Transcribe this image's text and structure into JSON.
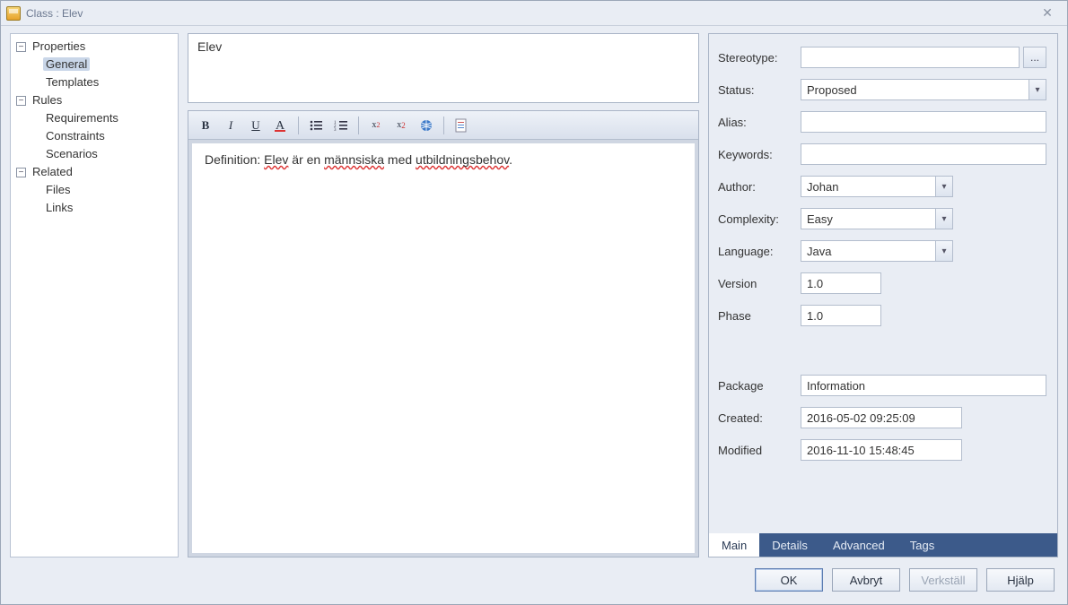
{
  "window": {
    "title": "Class : Elev"
  },
  "tree": {
    "properties": {
      "label": "Properties",
      "general": "General",
      "templates": "Templates"
    },
    "rules": {
      "label": "Rules",
      "requirements": "Requirements",
      "constraints": "Constraints",
      "scenarios": "Scenarios"
    },
    "related": {
      "label": "Related",
      "files": "Files",
      "links": "Links"
    },
    "selected": "General"
  },
  "name_box": {
    "value": "Elev"
  },
  "editor": {
    "text_prefix": "Definition: ",
    "w1": "Elev",
    "w2": " är en ",
    "w3": "männsiska",
    "w4": " med ",
    "w5": "utbildningsbehov",
    "w6": "."
  },
  "fields": {
    "stereotype": {
      "label": "Stereotype:",
      "value": ""
    },
    "status": {
      "label": "Status:",
      "value": "Proposed"
    },
    "alias": {
      "label": "Alias:",
      "value": ""
    },
    "keywords": {
      "label": "Keywords:",
      "value": ""
    },
    "author": {
      "label": "Author:",
      "value": "Johan"
    },
    "complexity": {
      "label": "Complexity:",
      "value": "Easy"
    },
    "language": {
      "label": "Language:",
      "value": "Java"
    },
    "version": {
      "label": "Version",
      "value": "1.0"
    },
    "phase": {
      "label": "Phase",
      "value": "1.0"
    },
    "package": {
      "label": "Package",
      "value": "Information"
    },
    "created": {
      "label": "Created:",
      "value": "2016-05-02 09:25:09"
    },
    "modified": {
      "label": "Modified",
      "value": "2016-11-10 15:48:45"
    }
  },
  "tabs": {
    "main": "Main",
    "details": "Details",
    "advanced": "Advanced",
    "tags": "Tags",
    "active": "main"
  },
  "buttons": {
    "ok": "OK",
    "cancel": "Avbryt",
    "apply": "Verkställ",
    "help": "Hjälp"
  },
  "ellipsis": "..."
}
